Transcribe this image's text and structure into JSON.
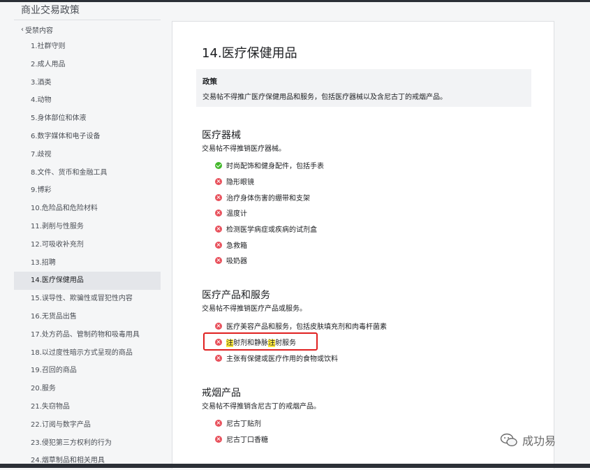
{
  "header": {
    "title": "商业交易政策"
  },
  "sidebar": {
    "back_label": "受禁内容",
    "items": [
      {
        "label": "1.社群守则"
      },
      {
        "label": "2.成人用品"
      },
      {
        "label": "3.酒类"
      },
      {
        "label": "4.动物"
      },
      {
        "label": "5.身体部位和体液"
      },
      {
        "label": "6.数字媒体和电子设备"
      },
      {
        "label": "7.歧视"
      },
      {
        "label": "8.文件、货币和金融工具"
      },
      {
        "label": "9.博彩"
      },
      {
        "label": "10.危险品和危险材料"
      },
      {
        "label": "11.剥削与性服务"
      },
      {
        "label": "12.可吸收补充剂"
      },
      {
        "label": "13.招聘"
      },
      {
        "label": "14.医疗保健用品",
        "active": true
      },
      {
        "label": "15.误导性、欺骗性或冒犯性内容"
      },
      {
        "label": "16.无货品出售"
      },
      {
        "label": "17.处方药品、管制药物和吸毒用具"
      },
      {
        "label": "18.以过度性暗示方式呈现的商品"
      },
      {
        "label": "19.召回的商品"
      },
      {
        "label": "20.服务"
      },
      {
        "label": "21.失窃物品"
      },
      {
        "label": "22.订阅与数字产品"
      },
      {
        "label": "23.侵犯第三方权利的行为"
      },
      {
        "label": "24.烟草制品和相关用具"
      }
    ]
  },
  "main": {
    "title": "14.医疗保健用品",
    "policy": {
      "label": "政策",
      "text": "交易帖不得推广医疗保健用品和服务，包括医疗器械以及含尼古丁的戒烟产品。"
    },
    "sections": [
      {
        "title": "医疗器械",
        "desc": "交易帖不得推销医疗器械。",
        "items": [
          {
            "text": "时尚配饰和健身配件，包括手表",
            "status": "allowed",
            "icon": "check-circle-icon"
          },
          {
            "text": "隐形眼镜",
            "status": "prohibited",
            "icon": "x-circle-icon"
          },
          {
            "text": "治疗身体伤害的绷带和支架",
            "status": "prohibited",
            "icon": "x-circle-icon"
          },
          {
            "text": "温度计",
            "status": "prohibited",
            "icon": "x-circle-icon"
          },
          {
            "text": "检测医学病症或疾病的试剂盒",
            "status": "prohibited",
            "icon": "x-circle-icon"
          },
          {
            "text": "急救箱",
            "status": "prohibited",
            "icon": "x-circle-icon"
          },
          {
            "text": "吸奶器",
            "status": "prohibited",
            "icon": "x-circle-icon"
          }
        ]
      },
      {
        "title": "医疗产品和服务",
        "desc": "交易帖不得推销医疗产品或服务。",
        "items": [
          {
            "text": "医疗美容产品和服务，包括皮肤填充剂和肉毒杆菌素",
            "status": "prohibited",
            "icon": "x-circle-icon"
          },
          {
            "text_parts": [
              "注",
              "射剂和静脉",
              "注",
              "射服务"
            ],
            "status": "prohibited",
            "icon": "x-circle-icon",
            "highlight_color": "#ffea3d"
          },
          {
            "text": "主张有保健或医疗作用的食物或饮料",
            "status": "prohibited",
            "icon": "x-circle-icon"
          }
        ]
      },
      {
        "title": "戒烟产品",
        "desc": "交易帖不得推销含尼古丁的戒烟产品。",
        "items": [
          {
            "text": "尼古丁贴剂",
            "status": "prohibited",
            "icon": "x-circle-icon"
          },
          {
            "text": "尼古丁口香糖",
            "status": "prohibited",
            "icon": "x-circle-icon"
          }
        ]
      }
    ]
  },
  "watermark": {
    "text": "成功易"
  },
  "colors": {
    "allowed": "#42b72a",
    "prohibited": "#e8505b",
    "annotation": "#e02020",
    "highlight": "#ffea3d"
  }
}
